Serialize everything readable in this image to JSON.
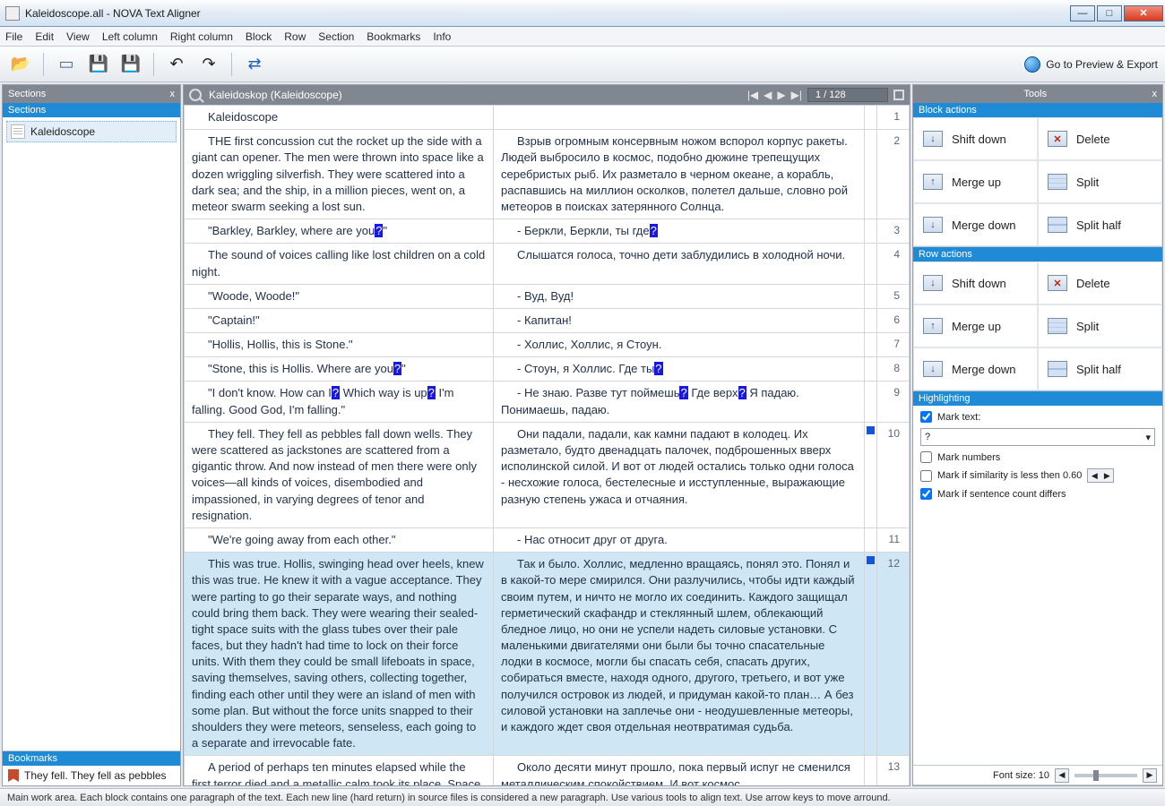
{
  "window": {
    "title": "Kaleidoscope.all - NOVA Text Aligner"
  },
  "menu": [
    "File",
    "Edit",
    "View",
    "Left column",
    "Right column",
    "Block",
    "Row",
    "Section",
    "Bookmarks",
    "Info"
  ],
  "toolbar": {
    "preview_label": "Go to Preview & Export"
  },
  "sections_panel": {
    "title": "Sections",
    "header": "Sections",
    "items": [
      "Kaleidoscope"
    ]
  },
  "bookmarks_panel": {
    "header": "Bookmarks",
    "items": [
      "They fell. They fell as pebbles"
    ]
  },
  "document": {
    "tab_title": "Kaleidoskop (Kaleidoscope)",
    "page_indicator": "1 / 128"
  },
  "rows": [
    {
      "n": 1,
      "left": "Kaleidoscope",
      "right": "",
      "flag": false,
      "selected": false,
      "indent": true
    },
    {
      "n": 2,
      "left": "THE first concussion cut the rocket up the side with a giant can opener. The men were thrown into space like a dozen wriggling silverfish. They were scattered into a dark sea; and the ship, in a million pieces, went on, a meteor swarm seeking a lost sun.",
      "right": "Взрыв огромным консервным ножом вспорол корпус ракеты. Людей выбросило в космос, подобно дюжине трепещущих серебристых рыб. Их разметало в черном океане, а корабль, распавшись на миллион осколков, полетел дальше, словно рой метеоров в поисках затерянного Солнца.",
      "flag": false,
      "indent": true
    },
    {
      "n": 3,
      "left": "\"Barkley, Barkley, where are you{?}\"",
      "right": "- Беркли, Беркли, ты где{?}",
      "flag": false,
      "indent": true
    },
    {
      "n": 4,
      "left": "The sound of voices calling like lost children on a cold night.",
      "right": "Слышатся голоса, точно дети заблудились в холодной ночи.",
      "flag": false,
      "indent": true
    },
    {
      "n": 5,
      "left": "\"Woode, Woode!\"",
      "right": "- Вуд, Вуд!",
      "flag": false,
      "indent": true
    },
    {
      "n": 6,
      "left": "\"Captain!\"",
      "right": "- Капитан!",
      "flag": false,
      "indent": true
    },
    {
      "n": 7,
      "left": "\"Hollis, Hollis, this is Stone.\"",
      "right": "- Холлис, Холлис, я Стоун.",
      "flag": false,
      "indent": true
    },
    {
      "n": 8,
      "left": "\"Stone, this is Hollis. Where are you{?}\"",
      "right": "- Стоун, я Холлис. Где ты{?}",
      "flag": false,
      "indent": true
    },
    {
      "n": 9,
      "left": "\"I don't know. How can I{?} Which way is up{?} I'm falling. Good God, I'm falling.\"",
      "right": "- Не знаю. Разве тут поймешь{?} Где верх{?} Я падаю. Понимаешь, падаю.",
      "flag": false,
      "indent": true
    },
    {
      "n": 10,
      "left": "They fell. They fell as pebbles fall down wells. They were scattered as jackstones are scattered from a gigantic throw. And now instead of men there were only voices—all kinds of voices, disembodied and impassioned, in varying degrees of tenor and resignation.",
      "right": "Они падали, падали, как камни падают в колодец. Их разметало, будто двенадцать палочек, подброшенных вверх исполинской силой. И вот от людей остались только одни голоса - несхожие голоса, бестелесные и исступленные, выражающие разную степень ужаса и отчаяния.",
      "flag": true,
      "indent": true
    },
    {
      "n": 11,
      "left": "\"We're going away from each other.\"",
      "right": "- Нас относит друг от друга.",
      "flag": false,
      "indent": true
    },
    {
      "n": 12,
      "left": "This was true. Hollis, swinging head over heels, knew this was true. He knew it with a vague acceptance. They were parting to go their separate ways, and nothing could bring them back. They were wearing their sealed-tight space suits with the glass tubes over their pale faces, but they hadn't had time to lock on their force units. With them they could be small lifeboats in space, saving themselves, saving others, collecting together, finding each other until they were an island of men with some plan. But without the force units snapped to their shoulders they were meteors, senseless, each going to a separate and irrevocable fate.",
      "right": "Так и было. Холлис, медленно вращаясь, понял это. Понял и в какой-то мере смирился. Они разлучились, чтобы идти каждый своим путем, и ничто не могло их соединить. Каждого защищал герметический скафандр и стеклянный шлем, облекающий бледное лицо, но они не успели надеть силовые установки. С маленькими двигателями они были бы точно спасательные лодки в космосе, могли бы спасать себя, спасать других, собираться вместе, находя одного, другого, третьего, и вот уже получился островок из людей, и придуман какой-то план… А без силовой установки на заплечье они - неодушевленные метеоры, и каждого ждет своя отдельная неотвратимая судьба.",
      "flag": true,
      "selected": true,
      "indent": true
    },
    {
      "n": 13,
      "left": "A period of perhaps ten minutes elapsed while the first terror died and a metallic calm took its place. Space began",
      "right": "Около десяти минут прошло, пока первый испуг не сменился металлическим спокойствием. И вот космос",
      "flag": false,
      "indent": true
    }
  ],
  "tools_panel": {
    "title": "Tools",
    "block_actions": {
      "header": "Block actions",
      "buttons": [
        "Shift down",
        "Delete",
        "Merge up",
        "Split",
        "Merge down",
        "Split half"
      ]
    },
    "row_actions": {
      "header": "Row actions",
      "buttons": [
        "Shift down",
        "Delete",
        "Merge up",
        "Split",
        "Merge down",
        "Split half"
      ]
    },
    "highlighting": {
      "header": "Highlighting",
      "mark_text_label": "Mark text:",
      "mark_text_value": "?",
      "mark_numbers_label": "Mark numbers",
      "similarity_label": "Mark if similarity is less then 0.60",
      "sentence_count_label": "Mark if sentence count differs",
      "mark_text_checked": true,
      "mark_numbers_checked": false,
      "similarity_checked": false,
      "sentence_count_checked": true
    },
    "font_size_label": "Font size: 10"
  },
  "status": "Main work area. Each block contains one paragraph of the text. Each new line (hard return) in source files is considered a new paragraph. Use various tools to align text. Use arrow keys  to move arround."
}
